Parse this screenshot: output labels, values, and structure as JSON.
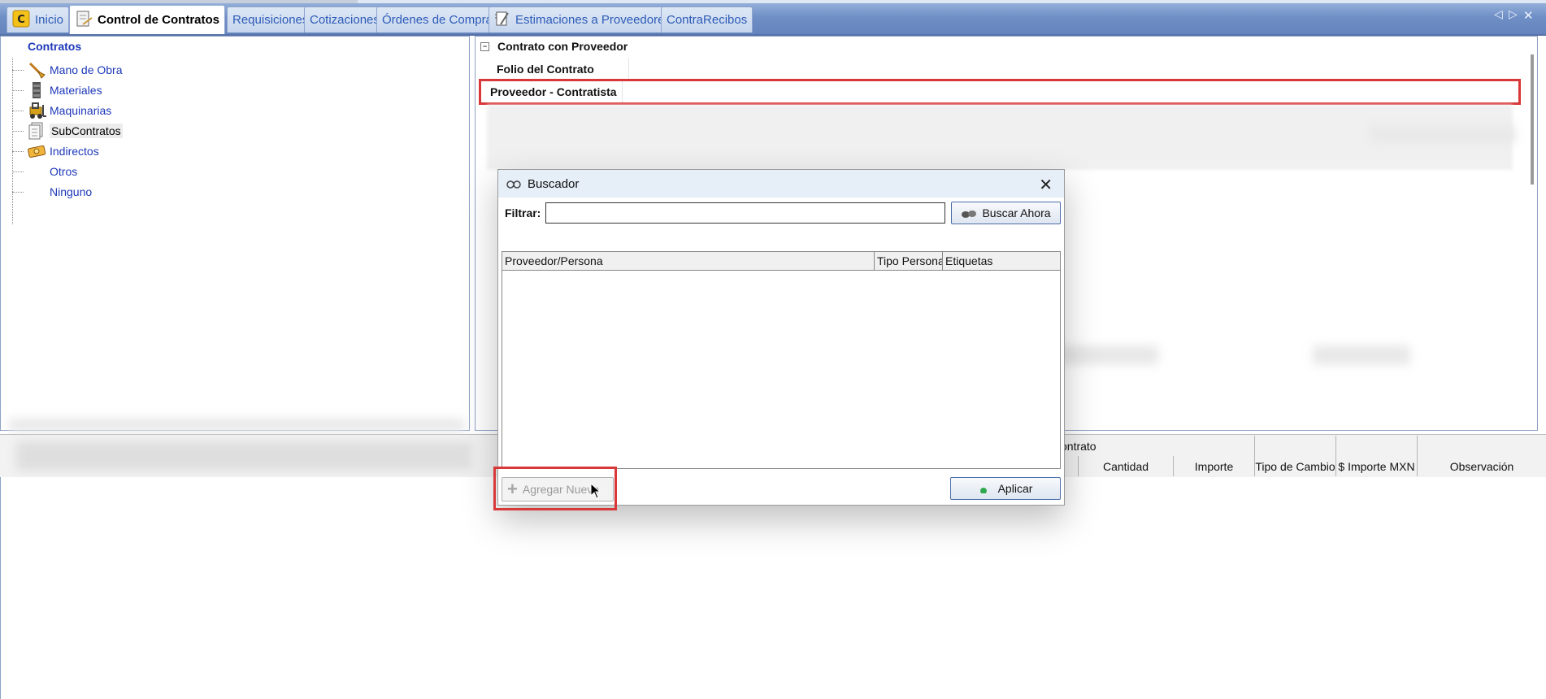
{
  "tabs": [
    {
      "label": "Inicio",
      "active": false
    },
    {
      "label": "Control de Contratos",
      "active": true
    },
    {
      "label": "Requisiciones",
      "active": false
    },
    {
      "label": "Cotizaciones",
      "active": false
    },
    {
      "label": "Órdenes de Compra",
      "active": false
    },
    {
      "label": "Estimaciones a Proveedores",
      "active": false
    },
    {
      "label": "ContraRecibos",
      "active": false
    }
  ],
  "tree": {
    "root": "Contratos",
    "items": [
      {
        "label": "Mano de Obra",
        "icon": "shovel-icon"
      },
      {
        "label": "Materiales",
        "icon": "bricks-icon"
      },
      {
        "label": "Maquinarias",
        "icon": "forklift-icon"
      },
      {
        "label": "SubContratos",
        "icon": "document-stack-icon",
        "selected": true
      },
      {
        "label": "Indirectos",
        "icon": "money-icon"
      },
      {
        "label": "Otros",
        "icon": ""
      },
      {
        "label": "Ninguno",
        "icon": ""
      }
    ]
  },
  "contract": {
    "section_title": "Contrato con Proveedor",
    "collapse_symbol": "⊟",
    "rows": [
      {
        "label": "Folio del Contrato",
        "value": ""
      },
      {
        "label": "Proveedor - Contratista",
        "value": ""
      }
    ]
  },
  "bottom_grid": {
    "group_header": "ontrato",
    "columns": [
      "Cantidad",
      "Importe",
      "Tipo de Cambio",
      "$ Importe MXN",
      "Observación"
    ]
  },
  "dialog": {
    "title": "Buscador",
    "close_symbol": "✕",
    "filter_label": "Filtrar:",
    "filter_value": "",
    "search_button": "Buscar Ahora",
    "columns": [
      "Proveedor/Persona",
      "Tipo Persona",
      "Etiquetas"
    ],
    "add_new_button": "Agregar Nuevo",
    "apply_button": "Aplicar"
  },
  "colors": {
    "accent_blue": "#1d38b9",
    "highlight_red": "#d9383a",
    "tabbar": "#6f8fc6"
  }
}
